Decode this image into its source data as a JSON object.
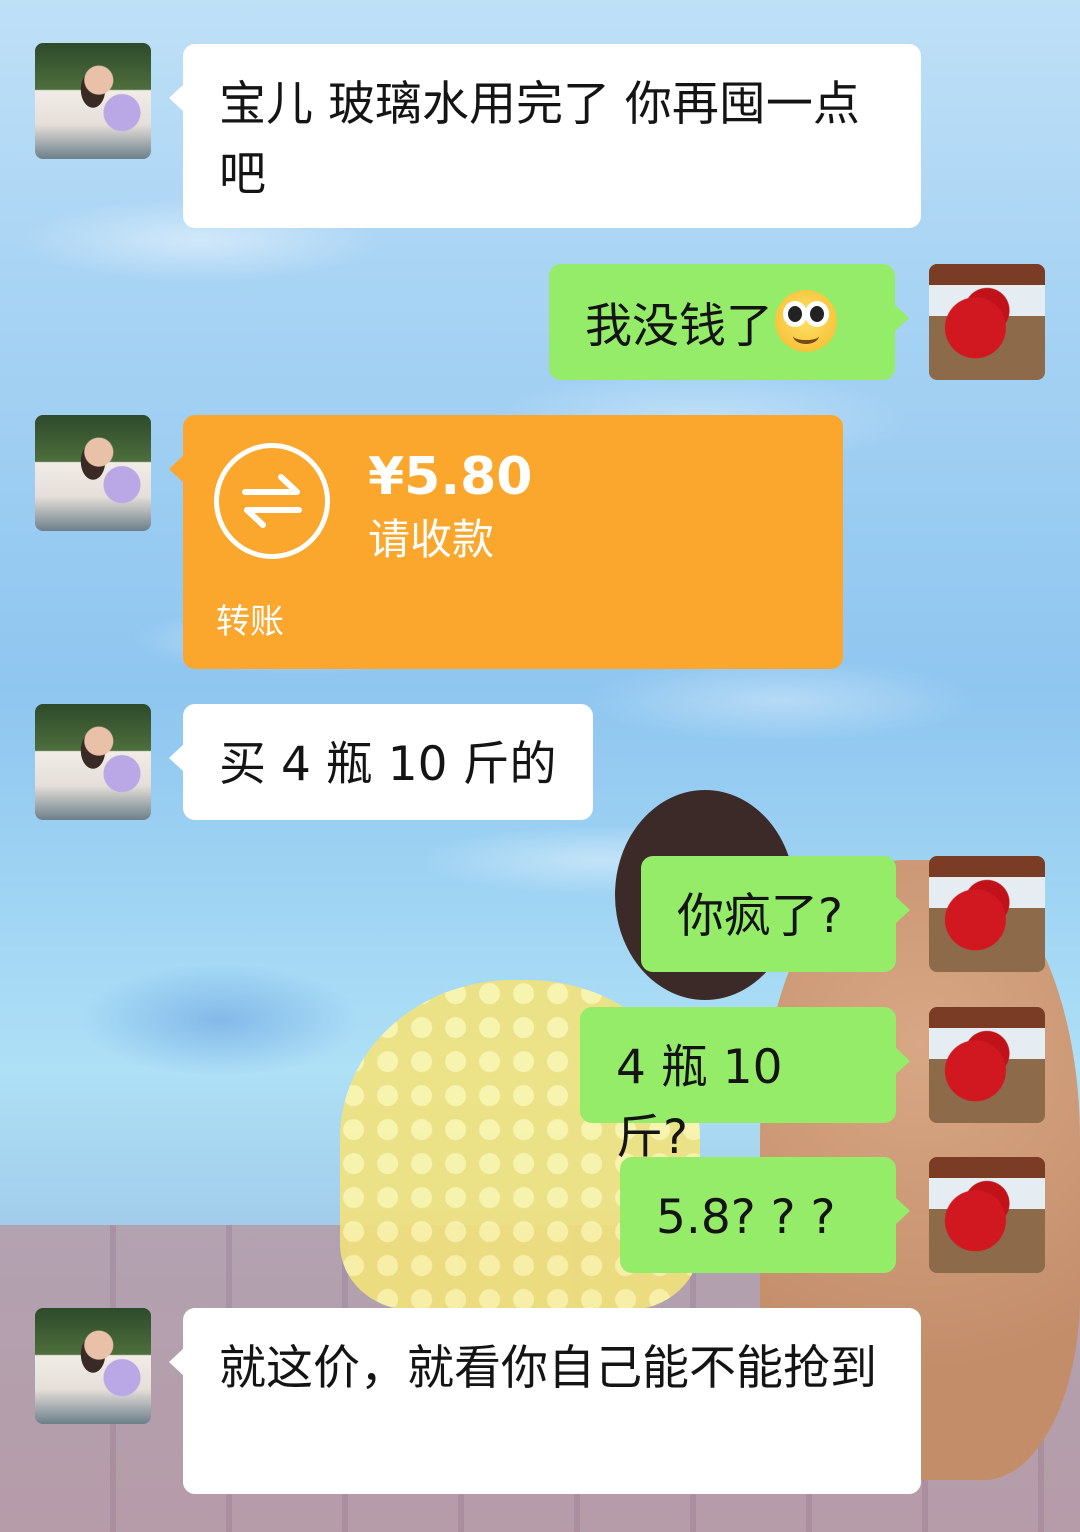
{
  "chat": {
    "messages": [
      {
        "side": "left",
        "text": "宝儿 玻璃水用完了 你再囤一点吧"
      },
      {
        "side": "right",
        "text": "我没钱了",
        "emoji": "sweat-smile-emoji"
      },
      {
        "side": "left",
        "type": "transfer",
        "amount": "¥5.80",
        "status": "请收款",
        "label": "转账"
      },
      {
        "side": "left",
        "text": "买 4 瓶 10 斤的"
      },
      {
        "side": "right",
        "text": "你疯了?"
      },
      {
        "side": "right",
        "text": "4 瓶 10 斤?"
      },
      {
        "side": "right",
        "text": "5.8? ? ?"
      },
      {
        "side": "left",
        "text": "就这价，就看你自己能不能抢到"
      }
    ]
  },
  "colors": {
    "outgoing_bubble": "#95ec69",
    "incoming_bubble": "#ffffff",
    "transfer_card": "#fba62c"
  },
  "icons": {
    "transfer": "transfer-arrows-icon",
    "emoji": "sweat-smile-emoji"
  }
}
